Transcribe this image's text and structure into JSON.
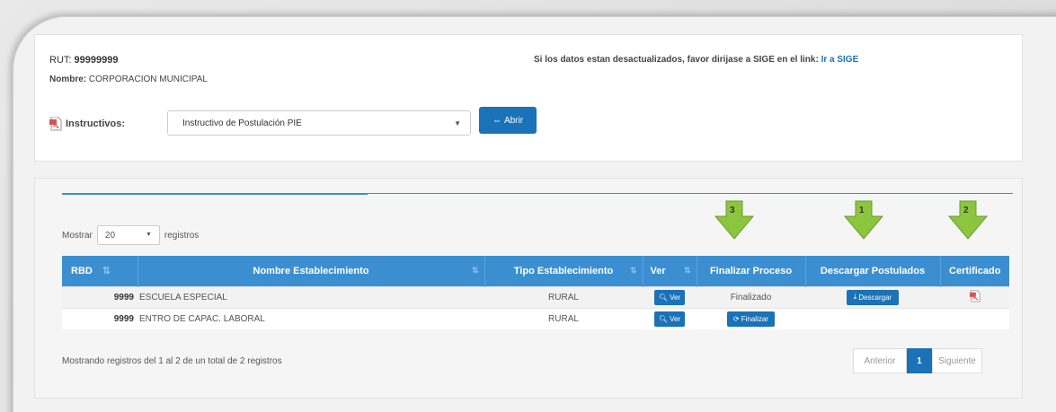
{
  "header": {
    "rut_label": "RUT:",
    "rut_value": "99999999",
    "nombre_label": "Nombre:",
    "nombre_value": "CORPORACION MUNICIPAL",
    "sige_text": "Si los datos estan desactualizados, favor dirijase a SIGE en el link:",
    "sige_link": "Ir a SIGE"
  },
  "instructivos": {
    "label": "Instructivos:",
    "selected": "Instructivo de Postulación PIE",
    "button": "Abrir"
  },
  "table_controls": {
    "mostrar": "Mostrar",
    "page_length": "20",
    "registros": "registros"
  },
  "markers": [
    "3",
    "1",
    "2"
  ],
  "table": {
    "headers": [
      "RBD",
      "Nombre Establecimiento",
      "Tipo Establecimiento",
      "Ver",
      "Finalizar Proceso",
      "Descargar Postulados",
      "Certificado"
    ],
    "rows": [
      {
        "rbd": "9999",
        "nombre": "ESCUELA ESPECIAL",
        "tipo": "RURAL",
        "ver": "Ver",
        "finalizar": "Finalizado",
        "descargar": "Descargar"
      },
      {
        "rbd": "9999",
        "nombre": "ENTRO DE CAPAC. LABORAL",
        "tipo": "RURAL",
        "ver": "Ver",
        "finalizar": "Finalizar",
        "descargar": ""
      }
    ]
  },
  "footer": {
    "info": "Mostrando registros del 1 al 2 de un total de 2 registros",
    "prev": "Anterior",
    "page": "1",
    "next": "Siguiente"
  },
  "colors": {
    "primary": "#1a72b8",
    "header_bg": "#3b8fd1",
    "arrow": "#8cc63f",
    "line_red": "#d9534f"
  }
}
